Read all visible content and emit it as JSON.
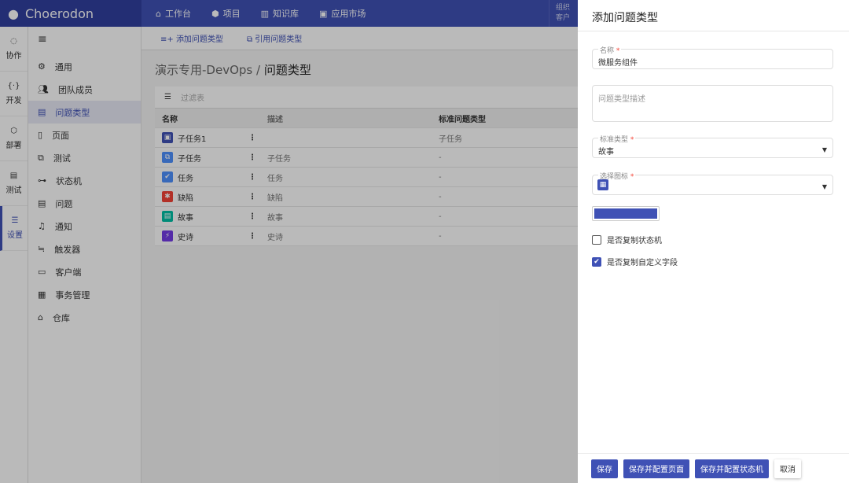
{
  "header": {
    "logo": "Choerodon",
    "nav": [
      "工作台",
      "项目",
      "知识库",
      "应用市场"
    ],
    "org_line1": "组织",
    "org_line2": "客户"
  },
  "rail": [
    {
      "label": "协作",
      "icon": "cycle-icon"
    },
    {
      "label": "开发",
      "icon": "code-icon"
    },
    {
      "label": "部署",
      "icon": "deploy-icon"
    },
    {
      "label": "测试",
      "icon": "clipboard-icon"
    },
    {
      "label": "设置",
      "icon": "settings-icon",
      "active": true
    }
  ],
  "menu": {
    "items": [
      "通用",
      "团队成员",
      "问题类型",
      "页面",
      "测试",
      "状态机",
      "问题",
      "通知",
      "触发器",
      "客户端",
      "事务管理",
      "仓库"
    ],
    "active": "问题类型"
  },
  "toolbar": {
    "add": "添加问题类型",
    "reference": "引用问题类型"
  },
  "breadcrumb": {
    "project": "演示专用-DevOps",
    "separator": "/",
    "page": "问题类型"
  },
  "table": {
    "filter_placeholder": "过滤表",
    "columns": [
      "名称",
      "描述",
      "标准问题类型"
    ],
    "rows": [
      {
        "name": "子任务1",
        "desc": "",
        "std": "子任务",
        "color": "#3f51b5",
        "glyph": "▣"
      },
      {
        "name": "子任务",
        "desc": "子任务",
        "std": "-",
        "color": "#4d90fe",
        "glyph": "⧉"
      },
      {
        "name": "任务",
        "desc": "任务",
        "std": "-",
        "color": "#4d90fe",
        "glyph": "✔"
      },
      {
        "name": "缺陷",
        "desc": "缺陷",
        "std": "-",
        "color": "#f44336",
        "glyph": "✱"
      },
      {
        "name": "故事",
        "desc": "故事",
        "std": "-",
        "color": "#00bfa5",
        "glyph": "▤"
      },
      {
        "name": "史诗",
        "desc": "史诗",
        "std": "-",
        "color": "#743be7",
        "glyph": "⚡"
      }
    ]
  },
  "panel": {
    "title": "添加问题类型",
    "name_label": "名称",
    "name_value": "微服务组件",
    "desc_placeholder": "问题类型描述",
    "std_label": "标准类型",
    "std_value": "故事",
    "icon_label": "选择图标",
    "icon": "grid-icon",
    "color": "#3f51b5",
    "copy_state_machine": {
      "label": "是否复制状态机",
      "checked": false
    },
    "copy_fields": {
      "label": "是否复制自定义字段",
      "checked": true
    },
    "buttons": {
      "save": "保存",
      "save_page": "保存并配置页面",
      "save_state": "保存并配置状态机",
      "cancel": "取消"
    }
  }
}
